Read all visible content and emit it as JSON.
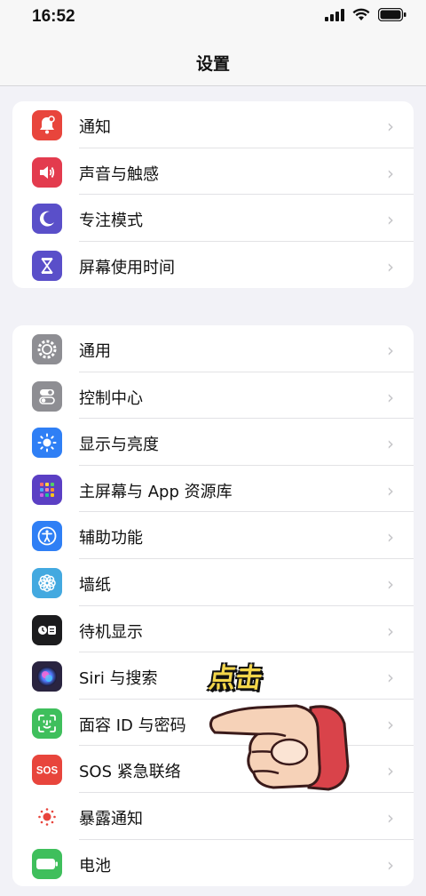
{
  "status_bar": {
    "time": "16:52"
  },
  "nav": {
    "title": "设置"
  },
  "group1": [
    {
      "label": "通知",
      "icon": "bell-icon",
      "color": "#e8453c"
    },
    {
      "label": "声音与触感",
      "icon": "speaker-icon",
      "color": "#e33b4e"
    },
    {
      "label": "专注模式",
      "icon": "moon-icon",
      "color": "#5a4fc9"
    },
    {
      "label": "屏幕使用时间",
      "icon": "hourglass-icon",
      "color": "#5a4fc9"
    }
  ],
  "group2": [
    {
      "label": "通用",
      "icon": "gear-icon",
      "color": "#8e8e93"
    },
    {
      "label": "控制中心",
      "icon": "toggles-icon",
      "color": "#8e8e93"
    },
    {
      "label": "显示与亮度",
      "icon": "sun-icon",
      "color": "#2f7ff5"
    },
    {
      "label": "主屏幕与 App 资源库",
      "icon": "app-grid-icon",
      "color": "#5b3fc4"
    },
    {
      "label": "辅助功能",
      "icon": "accessibility-icon",
      "color": "#2f7ff5"
    },
    {
      "label": "墙纸",
      "icon": "flower-icon",
      "color": "#43a9e0"
    },
    {
      "label": "待机显示",
      "icon": "standby-icon",
      "color": "#1c1c1e"
    },
    {
      "label": "Siri 与搜索",
      "icon": "siri-icon",
      "color": "#2a2440"
    },
    {
      "label": "面容 ID 与密码",
      "icon": "face-id-icon",
      "color": "#3fbf5c"
    },
    {
      "label": "SOS 紧急联络",
      "icon": "sos-icon",
      "color": "#e8453c"
    },
    {
      "label": "暴露通知",
      "icon": "exposure-icon",
      "color": "#ffffff"
    },
    {
      "label": "电池",
      "icon": "battery-icon",
      "color": "#3fbf5c"
    }
  ],
  "chevron": "›",
  "overlay": {
    "click_text": "点击",
    "hand": "pointing-hand-icon"
  }
}
